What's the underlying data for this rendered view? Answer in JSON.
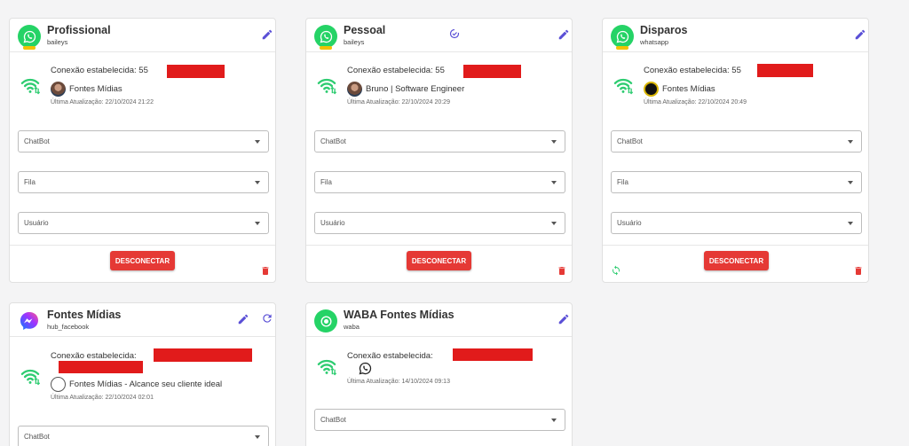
{
  "colors": {
    "accent": "#5a4fd6",
    "whatsapp": "#25d366",
    "danger": "#e53935",
    "redaction": "#e11b1b"
  },
  "common": {
    "disconnect_label": "DESCONECTAR",
    "select_chatbot": "ChatBot",
    "select_fila": "Fila",
    "select_usuario": "Usuário"
  },
  "cards": [
    {
      "title": "Profissional",
      "subtitle": "baileys",
      "connection_label": "Conexão estabelecida: 55",
      "profile_name": "Fontes Mídias",
      "updated": "Última Atualização: 22/10/2024 21:22"
    },
    {
      "title": "Pessoal",
      "subtitle": "baileys",
      "connection_label": "Conexão estabelecida: 55",
      "profile_name": "Bruno | Software Engineer",
      "updated": "Última Atualização: 22/10/2024 20:29"
    },
    {
      "title": "Disparos",
      "subtitle": "whatsapp",
      "connection_label": "Conexão estabelecida: 55",
      "profile_name": "Fontes Mídias",
      "updated": "Última Atualização: 22/10/2024 20:49"
    },
    {
      "title": "Fontes Mídias",
      "subtitle": "hub_facebook",
      "connection_label": "Conexão estabelecida:",
      "profile_name": "Fontes Mídias - Alcance seu cliente ideal",
      "updated": "Última Atualização: 22/10/2024 02:01"
    },
    {
      "title": "WABA Fontes Mídias",
      "subtitle": "waba",
      "connection_label": "Conexão estabelecida:",
      "updated": "Última Atualização: 14/10/2024 09:13"
    }
  ]
}
